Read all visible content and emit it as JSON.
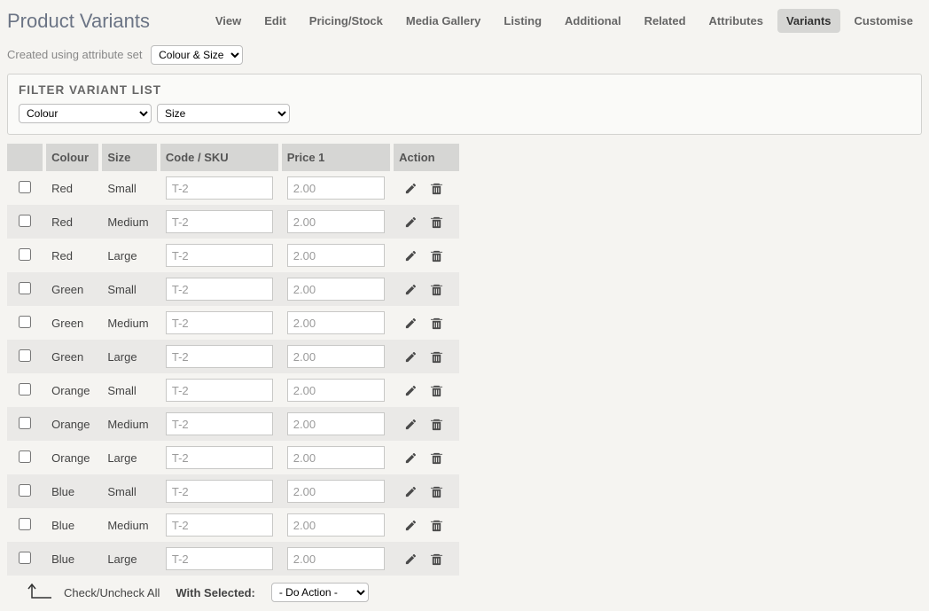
{
  "header": {
    "title": "Product Variants",
    "tabs": [
      {
        "label": "View"
      },
      {
        "label": "Edit"
      },
      {
        "label": "Pricing/Stock"
      },
      {
        "label": "Media Gallery"
      },
      {
        "label": "Listing"
      },
      {
        "label": "Additional"
      },
      {
        "label": "Related"
      },
      {
        "label": "Attributes"
      },
      {
        "label": "Variants",
        "active": true
      },
      {
        "label": "Customise"
      }
    ]
  },
  "attr_set": {
    "label": "Created using attribute set",
    "value": "Colour & Size"
  },
  "filter": {
    "title": "FILTER VARIANT LIST",
    "sel1": "Colour",
    "sel2": "Size"
  },
  "table": {
    "headers": {
      "check": "",
      "colour": "Colour",
      "size": "Size",
      "sku": "Code / SKU",
      "price": "Price 1",
      "action": "Action"
    },
    "rows": [
      {
        "colour": "Red",
        "size": "Small",
        "sku": "T-2",
        "price": "2.00"
      },
      {
        "colour": "Red",
        "size": "Medium",
        "sku": "T-2",
        "price": "2.00"
      },
      {
        "colour": "Red",
        "size": "Large",
        "sku": "T-2",
        "price": "2.00"
      },
      {
        "colour": "Green",
        "size": "Small",
        "sku": "T-2",
        "price": "2.00"
      },
      {
        "colour": "Green",
        "size": "Medium",
        "sku": "T-2",
        "price": "2.00"
      },
      {
        "colour": "Green",
        "size": "Large",
        "sku": "T-2",
        "price": "2.00"
      },
      {
        "colour": "Orange",
        "size": "Small",
        "sku": "T-2",
        "price": "2.00"
      },
      {
        "colour": "Orange",
        "size": "Medium",
        "sku": "T-2",
        "price": "2.00"
      },
      {
        "colour": "Orange",
        "size": "Large",
        "sku": "T-2",
        "price": "2.00"
      },
      {
        "colour": "Blue",
        "size": "Small",
        "sku": "T-2",
        "price": "2.00"
      },
      {
        "colour": "Blue",
        "size": "Medium",
        "sku": "T-2",
        "price": "2.00"
      },
      {
        "colour": "Blue",
        "size": "Large",
        "sku": "T-2",
        "price": "2.00"
      }
    ]
  },
  "bulk": {
    "check_label": "Check/Uncheck All",
    "with_selected": "With Selected:",
    "action_placeholder": "- Do Action -"
  }
}
